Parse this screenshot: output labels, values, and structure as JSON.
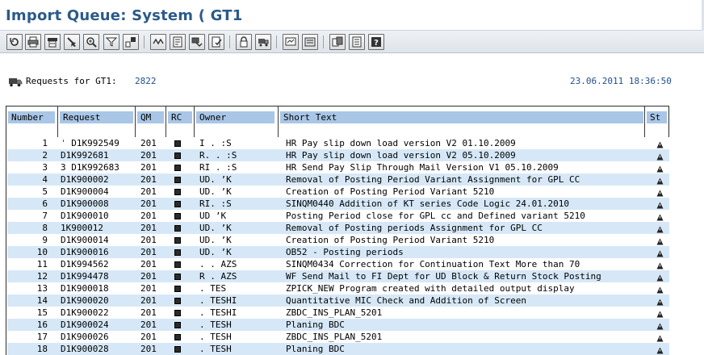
{
  "window": {
    "title": "Import Queue: System ( GT1"
  },
  "toolbar": {
    "buttons": [
      {
        "name": "refresh-icon"
      },
      {
        "name": "print-icon"
      },
      {
        "name": "print-preview-icon"
      },
      {
        "name": "find-icon"
      },
      {
        "name": "zoom-icon"
      },
      {
        "name": "filter-icon"
      },
      {
        "name": "settings-icon"
      },
      {
        "name": "sort-icon"
      },
      {
        "name": "details-icon"
      },
      {
        "name": "import-icon"
      },
      {
        "name": "check-icon"
      },
      {
        "name": "lock-icon"
      },
      {
        "name": "transport-icon"
      },
      {
        "name": "monitor-icon"
      },
      {
        "name": "log-icon"
      },
      {
        "name": "layout-icon"
      },
      {
        "name": "list-icon"
      },
      {
        "name": "help-icon"
      }
    ]
  },
  "info": {
    "label": "Requests for GT1:",
    "count": "2822",
    "datetime": "23.06.2011 18:36:50"
  },
  "table": {
    "columns": {
      "number": "Number",
      "request": "Request",
      "qm": "QM",
      "rc": "RC",
      "owner": "Owner",
      "short_text": "Short Text",
      "st": "St"
    },
    "rows": [
      {
        "number": "1",
        "request": "ˈ D1K992549",
        "qm": "201",
        "owner": "I .  :S",
        "text": "HR Pay slip down load version V2 01.10.2009"
      },
      {
        "number": "2",
        "request": "D1K992681",
        "qm": "201",
        "owner": "R. .  :S",
        "text": "HR Pay slip down load version V2 05.10.2009"
      },
      {
        "number": "3",
        "request": "3 D1K992683",
        "qm": "201",
        "owner": "RI .  :S",
        "text": "HR Send Pay Slip Through Mail Version V1 05.10.2009"
      },
      {
        "number": "4",
        "request": "D1K900002",
        "qm": "201",
        "owner": "UD. ’K",
        "text": "Removal of Posting Period Variant Assignment for GPL CC"
      },
      {
        "number": "5",
        "request": "D1K900004",
        "qm": "201",
        "owner": "UD. ’K",
        "text": "Creation of Posting Period Variant 5210"
      },
      {
        "number": "6",
        "request": "D1K900008",
        "qm": "201",
        "owner": "RI.  :S",
        "text": "SINQM0440 Addition of KT series Code Logic 24.01.2010"
      },
      {
        "number": "7",
        "request": "D1K900010",
        "qm": "201",
        "owner": "UD  ’K",
        "text": "Posting Period close for GPL cc and Defined variant 5210"
      },
      {
        "number": "8",
        "request": "1K900012",
        "qm": "201",
        "owner": "UD. ’K",
        "text": "Removal of Posting periods Assignment for GPL CC"
      },
      {
        "number": "9",
        "request": "D1K900014",
        "qm": "201",
        "owner": "UD. ’K",
        "text": "Creation of Posting Period Variant 5210"
      },
      {
        "number": "10",
        "request": "D1K900016",
        "qm": "201",
        "owner": "UD. ’K",
        "text": "OB52 - Posting periods"
      },
      {
        "number": "11",
        "request": "D1K994562",
        "qm": "201",
        "owner": ". . AZS",
        "text": "SINQM0434 Correction for Continuation Text More than 70"
      },
      {
        "number": "12",
        "request": "D1K994478",
        "qm": "201",
        "owner": "R . AZS",
        "text": "WF Send Mail to FI Dept for UD  Block & Return Stock Posting"
      },
      {
        "number": "13",
        "request": "D1K900018",
        "qm": "201",
        "owner": ". TES",
        "text": "ZPICK_NEW Program created with detailed output display"
      },
      {
        "number": "14",
        "request": "D1K900020",
        "qm": "201",
        "owner": ". TESHI",
        "text": "Quantitative MIC Check and Addition of Screen"
      },
      {
        "number": "15",
        "request": "D1K900022",
        "qm": "201",
        "owner": ". TESHI",
        "text": "ZBDC_INS_PLAN_5201"
      },
      {
        "number": "16",
        "request": "D1K900024",
        "qm": "201",
        "owner": ". TESH",
        "text": "Planing BDC"
      },
      {
        "number": "17",
        "request": "D1K900026",
        "qm": "201",
        "owner": ". TESH",
        "text": "ZBDC_INS_PLAN_5201"
      },
      {
        "number": "18",
        "request": "D1K900028",
        "qm": "201",
        "owner": ". TESH",
        "text": "Planing BDC"
      }
    ]
  }
}
